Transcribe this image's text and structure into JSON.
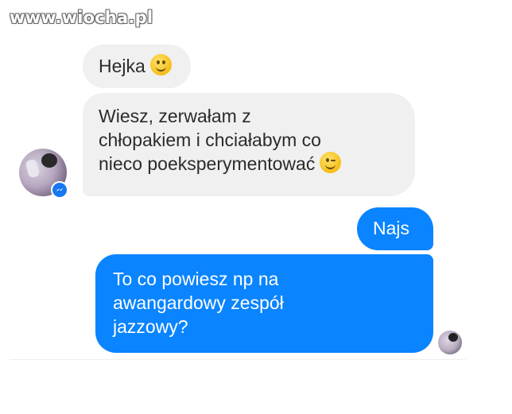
{
  "watermark": {
    "text": "www.wiocha.pl"
  },
  "conversation": {
    "messages": [
      {
        "side": "incoming",
        "text": "Hejka",
        "emoji": "smiling-face-icon"
      },
      {
        "side": "incoming",
        "lines": [
          "Wiesz, zerwałam z",
          "chłopakiem i chciałabym co",
          "nieco poeksperymentować"
        ],
        "emoji": "winking-face-icon"
      },
      {
        "side": "outgoing",
        "text": "Najs"
      },
      {
        "side": "outgoing",
        "lines": [
          "To co powiesz np na",
          "awangardowy zespół",
          "jazzowy?"
        ]
      }
    ]
  },
  "colors": {
    "incoming_bubble": "#f0f0f0",
    "outgoing_bubble": "#0a84ff",
    "messenger_badge": "#1877f2"
  }
}
